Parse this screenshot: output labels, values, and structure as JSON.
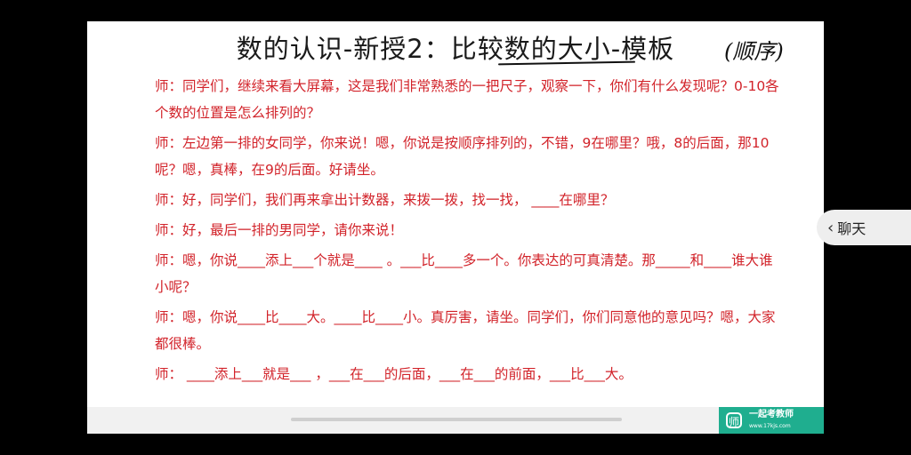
{
  "slide": {
    "title": "数的认识-新授2：比较数的大小-模板",
    "handwritten_note": "(顺序)",
    "lines": [
      "师：同学们，继续来看大屏幕，这是我们非常熟悉的一把尺子，观察一下，你们有什么发现呢？0-10各个数的位置是怎么排列的？",
      "师：左边第一排的女同学，你来说！嗯，你说是按顺序排列的，不错，9在哪里？哦，8的后面，那10呢？嗯，真棒，在9的后面。好请坐。",
      "师：好，同学们，我们再来拿出计数器，来拨一拨，找一找， ____在哪里？",
      "师：好，最后一排的男同学，请你来说！",
      "师：嗯，你说____添上___个就是____ 。___比____多一个。你表达的可真清楚。那_____和____谁大谁小呢？",
      "师：嗯，你说____比____大。____比____小。真厉害，请坐。同学们，你们同意他的意见吗？嗯，大家都很棒。",
      "师： ____添上___就是___ ，___在___的后面，___在___的前面，___比___大。"
    ],
    "logo": {
      "mark": "师",
      "name": "一起考教师",
      "url": "www.17kjs.com"
    }
  },
  "chat_button": {
    "icon": "chevron-left-icon",
    "label": "聊天"
  }
}
